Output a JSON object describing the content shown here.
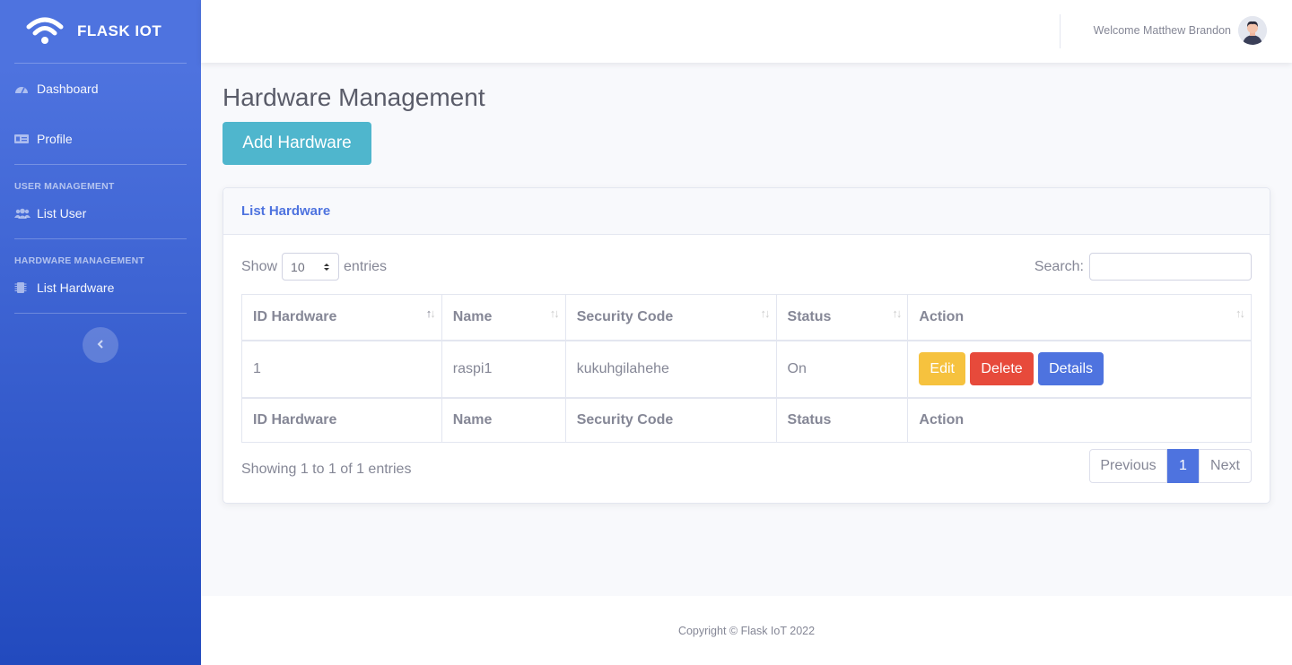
{
  "sidebar": {
    "brand": "FLASK IOT",
    "items": [
      {
        "label": "Dashboard",
        "icon": "tachometer-icon"
      },
      {
        "label": "Profile",
        "icon": "id-card-icon"
      }
    ],
    "user_heading": "USER MANAGEMENT",
    "user_items": [
      {
        "label": "List User",
        "icon": "users-icon"
      }
    ],
    "hardware_heading": "HARDWARE MANAGEMENT",
    "hardware_items": [
      {
        "label": "List Hardware",
        "icon": "microchip-icon"
      }
    ]
  },
  "topbar": {
    "welcome": "Welcome Matthew Brandon"
  },
  "page": {
    "title": "Hardware Management",
    "add_button": "Add Hardware"
  },
  "card": {
    "header": "List Hardware",
    "length": {
      "show": "Show",
      "value": "10",
      "entries": "entries"
    },
    "search_label": "Search:",
    "columns": [
      "ID Hardware",
      "Name",
      "Security Code",
      "Status",
      "Action"
    ],
    "rows": [
      {
        "id": "1",
        "name": "raspi1",
        "security_code": "kukuhgilahehe",
        "status": "On"
      }
    ],
    "actions": {
      "edit": "Edit",
      "delete": "Delete",
      "details": "Details"
    },
    "info": "Showing 1 to 1 of 1 entries",
    "pagination": {
      "previous": "Previous",
      "current": "1",
      "next": "Next"
    }
  },
  "footer": {
    "copyright": "Copyright © Flask IoT 2022"
  },
  "colors": {
    "primary": "#4e73df",
    "info": "#4fb6cd",
    "warning": "#f6c23e",
    "danger": "#e74a3b"
  }
}
